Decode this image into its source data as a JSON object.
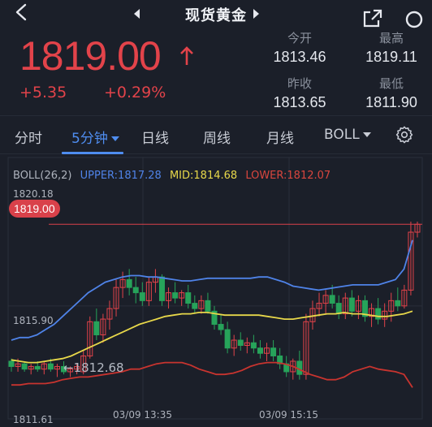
{
  "header": {
    "title": "现货黄金",
    "back_icon": "chevron-left-icon",
    "prev_icon": "triangle-left-icon",
    "next_icon": "triangle-right-icon",
    "share_icon": "share-icon",
    "search_icon": "search-icon"
  },
  "quote": {
    "price": "1819.00",
    "change": "+5.35",
    "change_pct": "+0.29%",
    "up_color": "#e2434a",
    "stats": {
      "open_label": "今开",
      "open": "1813.46",
      "high_label": "最高",
      "high": "1819.11",
      "prev_close_label": "昨收",
      "prev_close": "1813.65",
      "low_label": "最低",
      "low": "1811.90"
    }
  },
  "tabs": {
    "items": [
      "分时",
      "5分钟",
      "日线",
      "周线",
      "月线",
      "BOLL"
    ],
    "active": "5分钟",
    "accent": "#4f8df0",
    "settings_icon": "gear-icon"
  },
  "chart": {
    "legend": {
      "name": "BOLL(26,2)",
      "upper": "UPPER:1817.28",
      "mid": "MID:1814.68",
      "lower": "LOWER:1812.07"
    },
    "y_max_label": "1820.18",
    "y_mid_label": "1815.90",
    "y_min_label": "1811.61",
    "current_price_tag": "1819.00",
    "low_marker": "←1812.68",
    "time_labels": [
      "03/09 13:35",
      "03/09 15:15"
    ],
    "colors": {
      "up": "#e2434a",
      "down": "#27a35a",
      "upper": "#4f83e8",
      "mid": "#e8d84a",
      "lower": "#c8342f"
    }
  },
  "chart_data": {
    "type": "candlestick",
    "title": "",
    "ylim": [
      1811.61,
      1820.18
    ],
    "y_ticks": [
      1820.18,
      1815.9,
      1811.61
    ],
    "x_tick_labels": [
      "03/09 13:35",
      "03/09 15:15"
    ],
    "indicator": "BOLL(26,2)",
    "last_values": {
      "upper": 1817.28,
      "mid": 1814.68,
      "lower": 1812.07
    },
    "candles_ohlc": [
      [
        1813.8,
        1813.9,
        1813.4,
        1813.6
      ],
      [
        1813.6,
        1813.9,
        1813.4,
        1813.7
      ],
      [
        1813.7,
        1813.8,
        1813.4,
        1813.5
      ],
      [
        1813.5,
        1813.7,
        1813.3,
        1813.6
      ],
      [
        1813.6,
        1813.8,
        1813.4,
        1813.5
      ],
      [
        1813.5,
        1813.8,
        1813.3,
        1813.7
      ],
      [
        1813.7,
        1813.9,
        1813.4,
        1813.5
      ],
      [
        1813.5,
        1813.7,
        1813.2,
        1813.6
      ],
      [
        1813.6,
        1813.8,
        1813.3,
        1813.4
      ],
      [
        1813.4,
        1813.6,
        1813.2,
        1813.5
      ],
      [
        1813.5,
        1813.7,
        1813.3,
        1813.6
      ],
      [
        1813.4,
        1814.2,
        1813.3,
        1814.0
      ],
      [
        1814.0,
        1815.5,
        1813.9,
        1815.3
      ],
      [
        1815.3,
        1815.8,
        1814.6,
        1814.8
      ],
      [
        1814.8,
        1815.6,
        1814.5,
        1815.4
      ],
      [
        1815.4,
        1816.1,
        1815.0,
        1815.8
      ],
      [
        1815.8,
        1816.9,
        1815.5,
        1816.6
      ],
      [
        1816.6,
        1817.2,
        1816.2,
        1816.9
      ],
      [
        1816.9,
        1817.3,
        1816.3,
        1816.6
      ],
      [
        1816.6,
        1817.0,
        1816.0,
        1816.4
      ],
      [
        1816.4,
        1816.8,
        1815.9,
        1816.1
      ],
      [
        1816.1,
        1817.0,
        1815.9,
        1816.8
      ],
      [
        1816.8,
        1817.3,
        1816.4,
        1817.0
      ],
      [
        1817.0,
        1817.1,
        1815.9,
        1816.1
      ],
      [
        1816.1,
        1816.6,
        1815.8,
        1816.4
      ],
      [
        1816.4,
        1816.8,
        1816.0,
        1816.2
      ],
      [
        1816.2,
        1816.5,
        1815.9,
        1816.4
      ],
      [
        1816.4,
        1816.7,
        1815.8,
        1816.0
      ],
      [
        1816.0,
        1816.3,
        1815.6,
        1815.8
      ],
      [
        1815.8,
        1816.3,
        1815.6,
        1816.1
      ],
      [
        1816.1,
        1816.4,
        1815.6,
        1815.7
      ],
      [
        1815.7,
        1815.9,
        1815.0,
        1815.2
      ],
      [
        1815.2,
        1815.6,
        1814.8,
        1815.0
      ],
      [
        1815.0,
        1815.3,
        1814.1,
        1814.3
      ],
      [
        1814.3,
        1814.8,
        1814.0,
        1814.6
      ],
      [
        1814.6,
        1814.9,
        1814.2,
        1814.4
      ],
      [
        1814.4,
        1814.7,
        1814.1,
        1814.5
      ],
      [
        1814.5,
        1814.8,
        1814.1,
        1814.3
      ],
      [
        1814.3,
        1814.6,
        1813.9,
        1814.1
      ],
      [
        1814.1,
        1814.5,
        1813.8,
        1814.3
      ],
      [
        1814.3,
        1814.6,
        1813.8,
        1814.0
      ],
      [
        1814.0,
        1814.3,
        1813.5,
        1813.7
      ],
      [
        1813.7,
        1814.0,
        1813.2,
        1813.4
      ],
      [
        1813.4,
        1813.9,
        1813.1,
        1813.8
      ],
      [
        1813.8,
        1814.2,
        1813.1,
        1813.3
      ],
      [
        1813.3,
        1815.6,
        1813.1,
        1815.3
      ],
      [
        1815.3,
        1816.1,
        1815.0,
        1815.8
      ],
      [
        1815.8,
        1816.4,
        1815.5,
        1816.0
      ],
      [
        1816.0,
        1816.5,
        1815.6,
        1816.3
      ],
      [
        1816.3,
        1816.7,
        1815.8,
        1816.0
      ],
      [
        1816.0,
        1816.3,
        1815.4,
        1815.6
      ],
      [
        1815.6,
        1816.4,
        1815.4,
        1816.2
      ],
      [
        1816.2,
        1816.5,
        1815.5,
        1815.7
      ],
      [
        1815.7,
        1816.3,
        1815.4,
        1816.1
      ],
      [
        1816.1,
        1816.3,
        1815.3,
        1815.5
      ],
      [
        1815.5,
        1816.0,
        1815.1,
        1815.8
      ],
      [
        1815.8,
        1816.2,
        1815.2,
        1815.4
      ],
      [
        1815.4,
        1816.0,
        1815.1,
        1815.7
      ],
      [
        1815.7,
        1816.4,
        1815.3,
        1816.1
      ],
      [
        1816.1,
        1816.6,
        1815.7,
        1815.9
      ],
      [
        1815.9,
        1816.7,
        1815.8,
        1816.5
      ],
      [
        1816.5,
        1819.1,
        1816.3,
        1818.7
      ],
      [
        1818.7,
        1819.1,
        1818.5,
        1819.0
      ]
    ],
    "upper_band": [
      1814.6,
      1814.7,
      1814.7,
      1814.8,
      1815.0,
      1815.2,
      1815.5,
      1815.8,
      1816.1,
      1816.4,
      1816.6,
      1816.8,
      1816.9,
      1817.0,
      1817.05,
      1817.05,
      1817.0,
      1817.0,
      1816.95,
      1816.9,
      1816.85,
      1816.85,
      1816.9,
      1816.95,
      1816.95,
      1816.95,
      1816.95,
      1816.95,
      1816.95,
      1817.0,
      1817.0,
      1816.9,
      1816.8,
      1816.65,
      1816.6,
      1816.55,
      1816.5,
      1816.55,
      1816.6,
      1816.65,
      1816.7,
      1816.7,
      1816.7,
      1816.7,
      1816.8,
      1816.9,
      1817.3,
      1818.4
    ],
    "mid_band": [
      1813.85,
      1813.8,
      1813.75,
      1813.75,
      1813.8,
      1813.85,
      1813.9,
      1814.0,
      1814.15,
      1814.3,
      1814.45,
      1814.6,
      1814.75,
      1814.9,
      1815.05,
      1815.2,
      1815.3,
      1815.4,
      1815.5,
      1815.55,
      1815.6,
      1815.6,
      1815.65,
      1815.65,
      1815.6,
      1815.55,
      1815.55,
      1815.55,
      1815.55,
      1815.55,
      1815.5,
      1815.45,
      1815.4,
      1815.4,
      1815.45,
      1815.5,
      1815.55,
      1815.6,
      1815.6,
      1815.65,
      1815.6,
      1815.6,
      1815.55,
      1815.5,
      1815.5,
      1815.55,
      1815.6,
      1815.7
    ],
    "lower_band": [
      1812.9,
      1812.9,
      1812.95,
      1812.95,
      1812.95,
      1813.0,
      1813.1,
      1813.15,
      1813.2,
      1813.2,
      1813.25,
      1813.3,
      1813.35,
      1813.4,
      1813.5,
      1813.5,
      1813.6,
      1813.7,
      1813.75,
      1813.75,
      1813.75,
      1813.65,
      1813.5,
      1813.4,
      1813.3,
      1813.3,
      1813.35,
      1813.45,
      1813.6,
      1813.7,
      1813.75,
      1813.75,
      1813.7,
      1813.6,
      1813.45,
      1813.3,
      1813.2,
      1813.1,
      1813.1,
      1813.2,
      1813.4,
      1813.5,
      1813.6,
      1813.5,
      1813.45,
      1813.4,
      1813.3,
      1812.8
    ]
  }
}
